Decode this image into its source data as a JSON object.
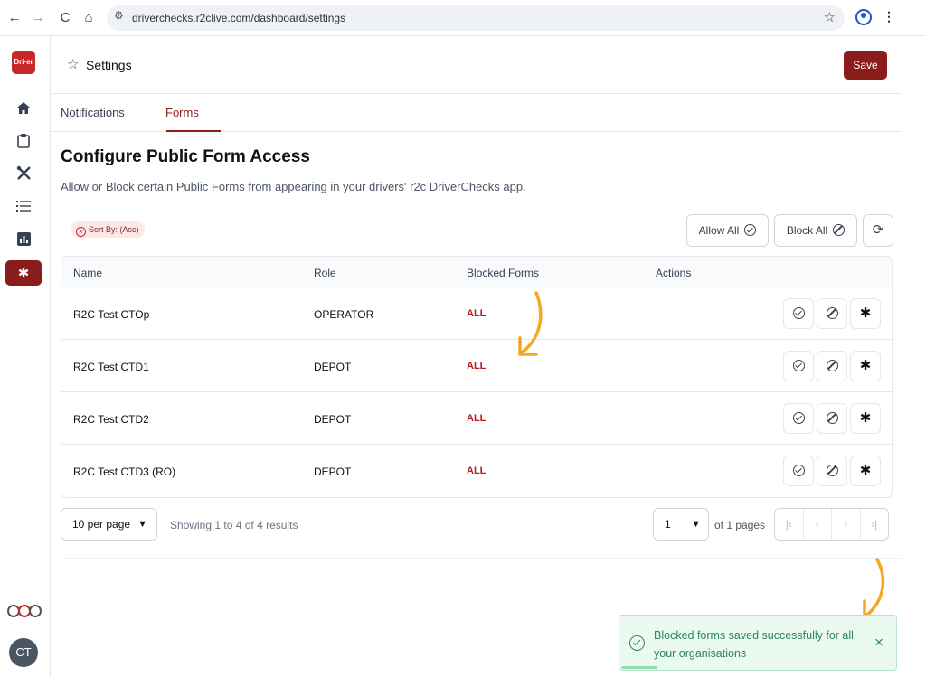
{
  "browser": {
    "url": "driverchecks.r2clive.com/dashboard/settings",
    "back_icon": "←",
    "forward_icon": "→",
    "reload_icon": "C",
    "home_icon": "⌂"
  },
  "sidebar": {
    "logo_text": "Dri·er",
    "brand_logo": "r2c",
    "avatar_initials": "CT",
    "items": [
      {
        "name": "home",
        "icon": "home-icon"
      },
      {
        "name": "clipboard",
        "icon": "clipboard-icon"
      },
      {
        "name": "tools",
        "icon": "tools-icon"
      },
      {
        "name": "list",
        "icon": "list-icon"
      },
      {
        "name": "reports",
        "icon": "bar-chart-icon"
      },
      {
        "name": "settings",
        "icon": "gear-icon",
        "active": true
      }
    ]
  },
  "header": {
    "title": "Settings",
    "save_label": "Save"
  },
  "tabs": [
    {
      "label": "Notifications",
      "active": false
    },
    {
      "label": "Forms",
      "active": true
    }
  ],
  "section": {
    "title": "Configure Public Form Access",
    "description": "Allow or Block certain Public Forms from appearing in your drivers' r2c DriverChecks app."
  },
  "sort_chip": "Sort By: (Asc)",
  "toolbar": {
    "allow_all": "Allow All",
    "block_all": "Block All"
  },
  "table": {
    "columns": [
      "Name",
      "Role",
      "Blocked Forms",
      "Actions"
    ],
    "rows": [
      {
        "name": "R2C Test CTOp",
        "role": "OPERATOR",
        "blocked": "ALL"
      },
      {
        "name": "R2C Test CTD1",
        "role": "DEPOT",
        "blocked": "ALL"
      },
      {
        "name": "R2C Test CTD2",
        "role": "DEPOT",
        "blocked": "ALL"
      },
      {
        "name": "R2C Test CTD3 (RO)",
        "role": "DEPOT",
        "blocked": "ALL"
      }
    ]
  },
  "pagination": {
    "per_page": "10 per page",
    "results": "Showing 1 to 4 of 4 results",
    "page": "1",
    "of_pages": "of 1 pages"
  },
  "toast": {
    "message": "Blocked forms saved successfully for all your organisations",
    "close": "×"
  },
  "colors": {
    "brand": "#8b1c1c",
    "success": "#2f855a",
    "annotation_arrow": "#f5a623"
  }
}
